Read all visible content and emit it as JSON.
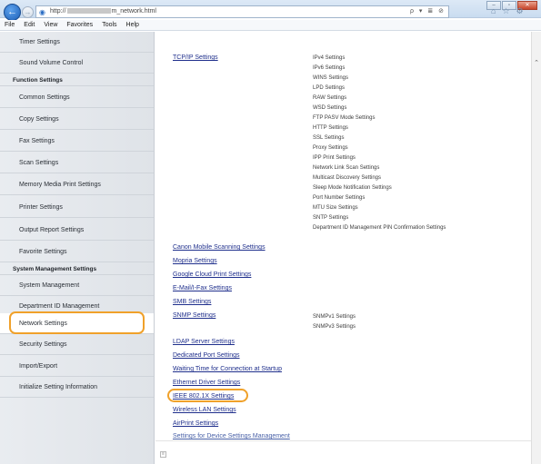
{
  "browser": {
    "url_prefix": "http://",
    "url_suffix": "m_network.html",
    "url_tools": "ρ ▾ ≣ ⊘",
    "window_buttons": [
      "–",
      "▫",
      "✕"
    ],
    "chrome_icons": [
      "⌂",
      "☆",
      "⚙"
    ]
  },
  "menu": [
    "File",
    "Edit",
    "View",
    "Favorites",
    "Tools",
    "Help"
  ],
  "sidebar": {
    "items": [
      {
        "label": "Timer Settings",
        "type": "item"
      },
      {
        "label": "Sound Volume Control",
        "type": "item"
      },
      {
        "label": "Function Settings",
        "type": "heading"
      },
      {
        "label": "Common Settings",
        "type": "item"
      },
      {
        "label": "Copy Settings",
        "type": "item"
      },
      {
        "label": "Fax Settings",
        "type": "item"
      },
      {
        "label": "Scan Settings",
        "type": "item"
      },
      {
        "label": "Memory Media Print Settings",
        "type": "item"
      },
      {
        "label": "Printer Settings",
        "type": "item"
      },
      {
        "label": "Output Report Settings",
        "type": "item"
      },
      {
        "label": "Favorite Settings",
        "type": "item"
      },
      {
        "label": "System Management Settings",
        "type": "heading"
      },
      {
        "label": "System Management",
        "type": "item"
      },
      {
        "label": "Department ID Management",
        "type": "item"
      },
      {
        "label": "Network Settings",
        "type": "item",
        "selected": true
      },
      {
        "label": "Security Settings",
        "type": "item"
      },
      {
        "label": "Import/Export",
        "type": "item"
      },
      {
        "label": "Initialize Setting Information",
        "type": "item"
      }
    ]
  },
  "content": {
    "links": [
      {
        "label": "TCP/IP Settings",
        "sub": [
          "IPv4 Settings",
          "IPv6 Settings",
          "WINS Settings",
          "LPD Settings",
          "RAW Settings",
          "WSD Settings",
          "FTP PASV Mode Settings",
          "HTTP Settings",
          "SSL Settings",
          "Proxy Settings",
          "IPP Print Settings",
          "Network Link Scan Settings",
          "Multicast Discovery Settings",
          "Sleep Mode Notification Settings",
          "Port Number Settings",
          "MTU Size Settings",
          "SNTP Settings",
          "Department ID Management PIN Confirmation Settings"
        ]
      },
      {
        "label": "Canon Mobile Scanning Settings",
        "sub": []
      },
      {
        "label": "Mopria Settings",
        "sub": []
      },
      {
        "label": "Google Cloud Print Settings",
        "sub": []
      },
      {
        "label": "E-Mail/I-Fax Settings",
        "sub": []
      },
      {
        "label": "SMB Settings",
        "sub": []
      },
      {
        "label": "SNMP Settings",
        "sub": [
          "SNMPv1 Settings",
          "SNMPv3 Settings"
        ]
      },
      {
        "label": "LDAP Server Settings",
        "sub": []
      },
      {
        "label": "Dedicated Port Settings",
        "sub": []
      },
      {
        "label": "Waiting Time for Connection at Startup",
        "sub": []
      },
      {
        "label": "Ethernet Driver Settings",
        "sub": []
      },
      {
        "label": "IEEE 802.1X Settings",
        "sub": [],
        "highlighted": true
      },
      {
        "label": "Wireless LAN Settings",
        "sub": []
      },
      {
        "label": "AirPrint Settings",
        "sub": []
      },
      {
        "label": "Settings for Device Settings Management",
        "sub": [],
        "muted": true
      }
    ]
  },
  "colors": {
    "highlight": "#f0a12a",
    "link": "#1f2f8c",
    "sidebar_bg": "#e4e8ec"
  }
}
